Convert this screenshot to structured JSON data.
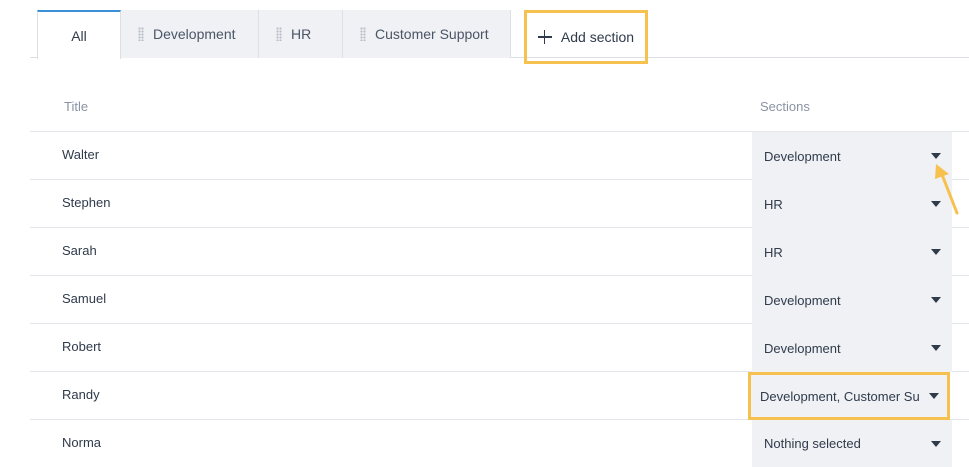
{
  "tabs": [
    {
      "label": "All",
      "active": true
    },
    {
      "label": "Development",
      "active": false
    },
    {
      "label": "HR",
      "active": false
    },
    {
      "label": "Customer Support",
      "active": false
    }
  ],
  "add_section_label": "Add section",
  "table": {
    "columns": [
      "Title",
      "Sections"
    ],
    "rows": [
      {
        "title": "Walter",
        "sections": "Development"
      },
      {
        "title": "Stephen",
        "sections": "HR"
      },
      {
        "title": "Sarah",
        "sections": "HR"
      },
      {
        "title": "Samuel",
        "sections": "Development"
      },
      {
        "title": "Robert",
        "sections": "Development"
      },
      {
        "title": "Randy",
        "sections": "Development, Customer Support"
      },
      {
        "title": "Norma",
        "sections": "Nothing selected"
      }
    ]
  },
  "colors": {
    "highlight": "#f7c14f",
    "tab_active_border": "#3a8fd6",
    "select_bg": "#eff1f4"
  },
  "icons": {
    "add": "plus-icon",
    "dropdown": "caret-down-icon",
    "tab_handle": "drag-handle-icon",
    "annotation": "arrow-annotation-icon"
  }
}
